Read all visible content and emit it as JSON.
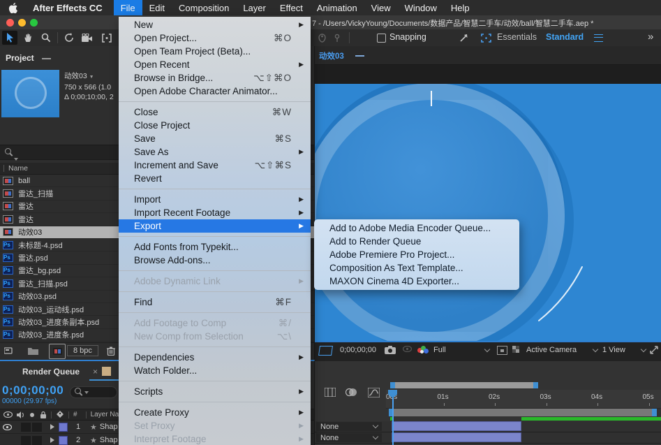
{
  "colors": {
    "menubar_highlight": "#1a7ce5",
    "menu_highlight": "#2678e4",
    "accent_blue": "#42a4f5",
    "viewer_blue": "#2e86d2",
    "layer_bar_purple": "#7b85cb",
    "render_bar_green": "#2ab82a",
    "traffic_red": "#ff5f57",
    "traffic_yellow": "#febc2e",
    "traffic_green": "#28c840",
    "tab_swatch_tan": "#c9ad83"
  },
  "menubar": {
    "app_name": "After Effects CC",
    "items": [
      {
        "label": "File",
        "active": true
      },
      {
        "label": "Edit"
      },
      {
        "label": "Composition"
      },
      {
        "label": "Layer"
      },
      {
        "label": "Effect"
      },
      {
        "label": "Animation"
      },
      {
        "label": "View"
      },
      {
        "label": "Window"
      },
      {
        "label": "Help"
      }
    ]
  },
  "titlebar": {
    "document_path": "7 - /Users/VickyYoung/Documents/数据产品/智慧二手车/动效/ball/智慧二手车.aep *"
  },
  "toolbar": {
    "snapping_label": "Snapping",
    "workspaces": [
      {
        "label": "Essentials"
      },
      {
        "label": "Standard",
        "active": true
      }
    ],
    "overflow_glyph": "»"
  },
  "file_menu": {
    "items": [
      {
        "label": "New",
        "submenu": true
      },
      {
        "label": "Open Project...",
        "shortcut": "⌘O"
      },
      {
        "label": "Open Team Project (Beta)..."
      },
      {
        "label": "Open Recent",
        "submenu": true
      },
      {
        "label": "Browse in Bridge...",
        "shortcut": "⌥⇧⌘O"
      },
      {
        "label": "Open Adobe Character Animator..."
      },
      {
        "separator": true
      },
      {
        "label": "Close",
        "shortcut": "⌘W"
      },
      {
        "label": "Close Project"
      },
      {
        "label": "Save",
        "shortcut": "⌘S"
      },
      {
        "label": "Save As",
        "submenu": true
      },
      {
        "label": "Increment and Save",
        "shortcut": "⌥⇧⌘S"
      },
      {
        "label": "Revert"
      },
      {
        "separator": true
      },
      {
        "label": "Import",
        "submenu": true
      },
      {
        "label": "Import Recent Footage",
        "submenu": true
      },
      {
        "label": "Export",
        "submenu": true,
        "highlighted": true
      },
      {
        "separator": true
      },
      {
        "label": "Add Fonts from Typekit..."
      },
      {
        "label": "Browse Add-ons..."
      },
      {
        "separator": true
      },
      {
        "label": "Adobe Dynamic Link",
        "submenu": true,
        "disabled": true
      },
      {
        "separator": true
      },
      {
        "label": "Find",
        "shortcut": "⌘F"
      },
      {
        "separator": true
      },
      {
        "label": "Add Footage to Comp",
        "shortcut": "⌘/",
        "disabled": true
      },
      {
        "label": "New Comp from Selection",
        "shortcut": "⌥\\",
        "disabled": true
      },
      {
        "separator": true
      },
      {
        "label": "Dependencies",
        "submenu": true
      },
      {
        "label": "Watch Folder..."
      },
      {
        "separator": true
      },
      {
        "label": "Scripts",
        "submenu": true
      },
      {
        "separator": true
      },
      {
        "label": "Create Proxy",
        "submenu": true
      },
      {
        "label": "Set Proxy",
        "submenu": true,
        "disabled": true
      },
      {
        "label": "Interpret Footage",
        "submenu": true,
        "disabled": true
      }
    ]
  },
  "export_submenu": {
    "items": [
      "Add to Adobe Media Encoder Queue...",
      "Add to Render Queue",
      "Adobe Premiere Pro Project...",
      "Composition As Text Template...",
      "MAXON Cinema 4D Exporter..."
    ]
  },
  "project_panel": {
    "tab_label": "Project",
    "preview": {
      "comp_name": "动效03",
      "dropdown_glyph": "▼",
      "info_line1": "750 x 566 (1.0",
      "info_line2": "Δ 0;00;10;00, 2"
    },
    "name_header": "Name",
    "items": [
      {
        "name": "ball",
        "type": "comp"
      },
      {
        "name": "雷达_扫描",
        "type": "comp"
      },
      {
        "name": "雷达",
        "type": "comp"
      },
      {
        "name": "雷达",
        "type": "comp"
      },
      {
        "name": "动效03",
        "type": "comp",
        "selected": true
      },
      {
        "name": "未标题-4.psd",
        "type": "psd"
      },
      {
        "name": "雷达.psd",
        "type": "psd"
      },
      {
        "name": "雷达_bg.psd",
        "type": "psd"
      },
      {
        "name": "雷达_扫描.psd",
        "type": "psd"
      },
      {
        "name": "动效03.psd",
        "type": "psd"
      },
      {
        "name": "动效03_运动线.psd",
        "type": "psd"
      },
      {
        "name": "动效03_进度条副本.psd",
        "type": "psd"
      },
      {
        "name": "动效03_进度条.psd",
        "type": "psd"
      }
    ],
    "bit_depth_label": "8 bpc",
    "ps_icon_text": "Ps"
  },
  "render_queue_panel": {
    "tab_label": "Render Queue",
    "close_glyph": "×",
    "timecode": "0;00;00;00",
    "frame_info": "00000 (29.97 fps)",
    "index_header": "#",
    "layer_name_header": "Layer Na",
    "rows": [
      {
        "num": "1",
        "name": "Shap",
        "star": "★",
        "visible": true
      },
      {
        "num": "2",
        "name": "Shap",
        "star": "★"
      }
    ]
  },
  "composition_panel": {
    "tab_label": "动效03",
    "timecode": "0;00;00;00",
    "magnification": "Full",
    "camera_view": "Active Camera",
    "view_layout": "1 View"
  },
  "timeline": {
    "ruler_ticks": [
      "00s",
      "01s",
      "02s",
      "03s",
      "04s",
      "05s"
    ],
    "rows": [
      {
        "parent": "None"
      },
      {
        "parent": "None"
      }
    ]
  }
}
